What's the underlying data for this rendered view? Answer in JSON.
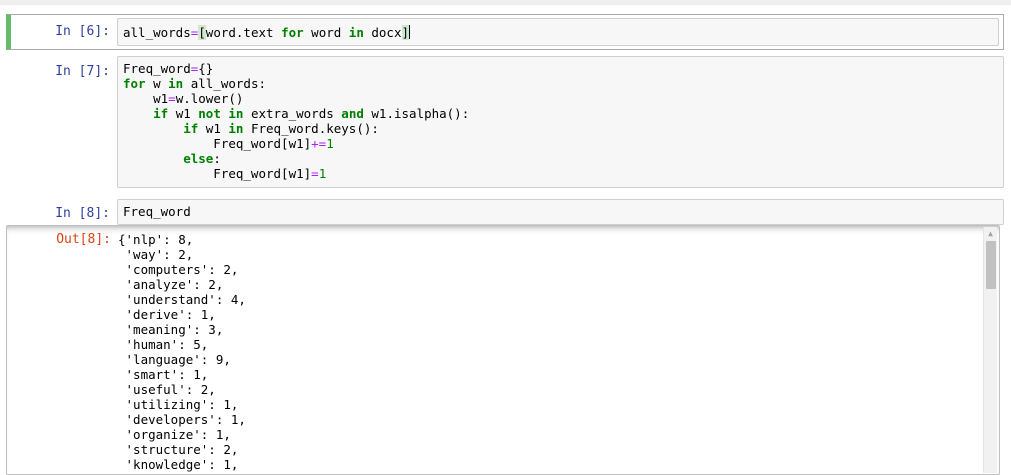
{
  "cells": [
    {
      "prompt": "In [6]:",
      "code_lines": [
        "all_words=[word.text for word in docx]"
      ]
    },
    {
      "prompt": "In [7]:",
      "code_lines": [
        "Freq_word={}",
        "for w in all_words:",
        "    w1=w.lower()",
        "    if w1 not in extra_words and w1.isalpha():",
        "        if w1 in Freq_word.keys():",
        "            Freq_word[w1]+=1",
        "        else:",
        "            Freq_word[w1]=1"
      ]
    },
    {
      "prompt": "In [8]:",
      "code_lines": [
        "Freq_word"
      ]
    }
  ],
  "output": {
    "prompt": "Out[8]:",
    "lines": [
      "{'nlp': 8,",
      " 'way': 2,",
      " 'computers': 2,",
      " 'analyze': 2,",
      " 'understand': 4,",
      " 'derive': 1,",
      " 'meaning': 3,",
      " 'human': 5,",
      " 'language': 9,",
      " 'smart': 1,",
      " 'useful': 2,",
      " 'utilizing': 1,",
      " 'developers': 1,",
      " 'organize': 1,",
      " 'structure': 2,",
      " 'knowledge': 1,"
    ]
  },
  "scrollbar": {
    "up_arrow": "▲"
  },
  "colors": {
    "in_prompt": "#303f9f",
    "out_prompt": "#d84315",
    "keyword": "#008000",
    "operator": "#aa22ff",
    "edit_mode_border": "#66bb6a"
  }
}
